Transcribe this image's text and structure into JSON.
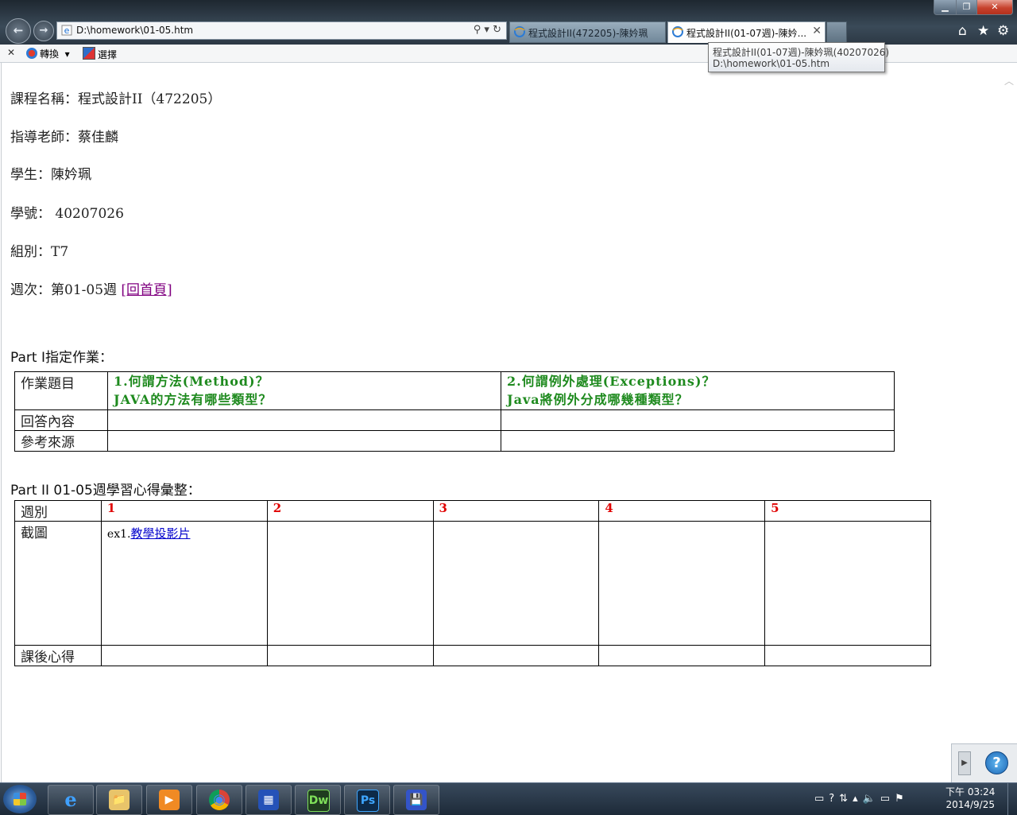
{
  "browser": {
    "address": "D:\\homework\\01-05.htm",
    "address_ctrls": "⚲ ▾ ↻",
    "tabs": [
      {
        "label": "程式設計II(472205)-陳妗珮-4..."
      },
      {
        "label": "程式設計II(01-07週)-陳妗..."
      }
    ],
    "tooltip": {
      "line1": "程式設計II(01-07週)-陳妗珮(40207026)",
      "line2": "D:\\homework\\01-05.htm"
    },
    "commandbar": {
      "translate": "轉換",
      "select": "選擇"
    }
  },
  "page": {
    "course": "課程名稱：程式設計II（472205）",
    "teacher": "指導老師：蔡佳麟",
    "student": "學生：陳妗珮",
    "student_id": "學號： 40207026",
    "group": "組別：T7",
    "week_prefix": "週次：第01-05週 ",
    "home_link": "[回首頁]",
    "part1": {
      "en": "Part I",
      "zh": "指定作業：",
      "row_topic": "作業題目",
      "row_answer": "回答內容",
      "row_source": "參考來源",
      "q1_line1": "1.何謂方法(Method)？",
      "q1_line2": "JAVA的方法有哪些類型？",
      "q2_line1": "2.何謂例外處理(Exceptions)？",
      "q2_line2": "Java將例外分成哪幾種類型？"
    },
    "part2": {
      "en": "Part II 01-05",
      "zh": "週學習心得彙整：",
      "row_week": "週別",
      "row_screenshot": "截圖",
      "row_reflection": "課後心得",
      "weeks": [
        "1",
        "2",
        "3",
        "4",
        "5"
      ],
      "ex1_prefix": "ex1.",
      "ex1_link": "教學投影片"
    }
  },
  "taskbar": {
    "apps": [
      "e",
      "📁",
      "▶",
      "◉",
      "▦",
      "Dw",
      "Ps",
      "💾"
    ],
    "tray": "▭?⇅▴🔈▭⚑",
    "clock_time": "下午 03:24",
    "clock_date": "2014/9/25"
  },
  "colors": {
    "question_green": "#1e8a1e",
    "week_red": "#e00000",
    "link_visited": "#800080",
    "link": "#0000cc"
  }
}
